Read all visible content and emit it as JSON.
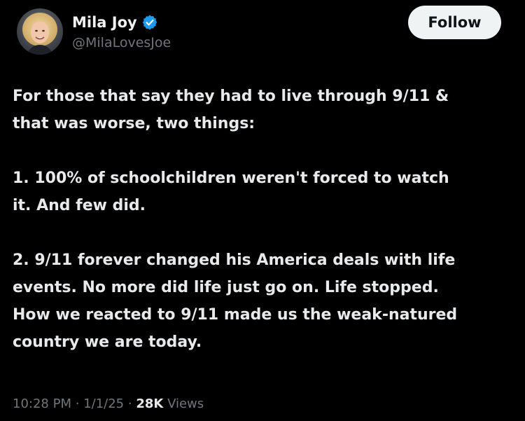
{
  "author": {
    "display_name": "Mila Joy",
    "handle": "@MilaLovesJoe",
    "verified": true,
    "verified_color": "#1d9bf0",
    "avatar_icon": "profile-photo"
  },
  "follow_button": {
    "label": "Follow"
  },
  "tweet": {
    "lines": [
      "For those that say they had to live through 9/11 &",
      "that was worse, two things:",
      "",
      "1. 100% of schoolchildren weren't forced to watch",
      "it. And few did.",
      "",
      "2. 9/11 forever changed his America deals with life",
      "events. No more did life just go on. Life stopped.",
      "How we reacted to 9/11 made us the weak-natured",
      "country we are today."
    ]
  },
  "meta": {
    "time": "10:28 PM",
    "separator": "·",
    "date": "1/1/25",
    "views_count": "28K",
    "views_label": "Views"
  },
  "colors": {
    "background": "#000000",
    "text_primary": "#e7e9ea",
    "text_secondary": "#71767b",
    "follow_bg": "#eff3f4",
    "follow_text": "#0f1419"
  }
}
